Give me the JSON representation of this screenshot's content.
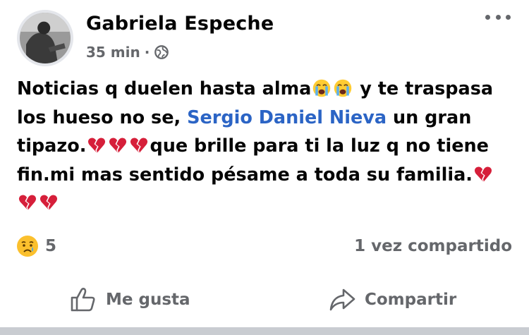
{
  "post": {
    "author": "Gabriela Espeche",
    "time": "35 min",
    "separator": "·",
    "privacy_icon": "globe-icon",
    "more_icon": "more-options-icon",
    "text": {
      "part1": "Noticias q duelen hasta alma",
      "part2": " y te traspasa los hueso no se, ",
      "mention": "Sergio Daniel Nieva",
      "part3": " un gran tipazo.",
      "part4": "que brille para ti la luz q no tiene fin.mi mas sentido pésame a toda su familia."
    },
    "emojis": {
      "crying": "loudly-crying-face-emoji",
      "broken_heart": "broken-heart-emoji"
    }
  },
  "stats": {
    "reaction_icon": "sad-reaction-icon",
    "reaction_count": "5",
    "shares": "1 vez compartido"
  },
  "actions": {
    "like_label": "Me gusta",
    "like_icon": "thumbs-up-icon",
    "share_label": "Compartir",
    "share_icon": "share-arrow-icon"
  },
  "colors": {
    "mention": "#2b64c5",
    "secondary_text": "#65676b",
    "primary_text": "#050505",
    "divider": "#c9ccd1"
  }
}
